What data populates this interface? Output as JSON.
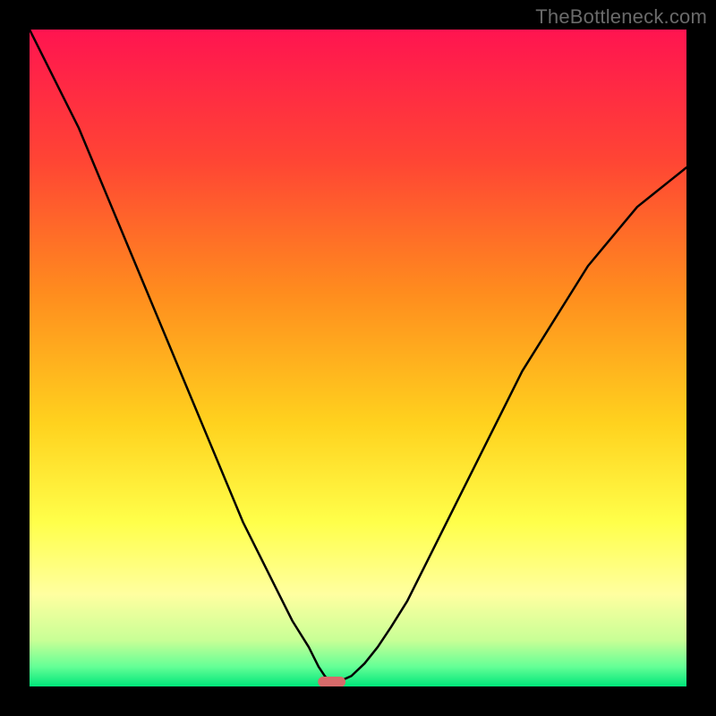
{
  "watermark": "TheBottleneck.com",
  "chart_data": {
    "type": "line",
    "title": "",
    "xlabel": "",
    "ylabel": "",
    "xlim": [
      0,
      100
    ],
    "ylim": [
      0,
      100
    ],
    "background": {
      "type": "vertical-gradient",
      "stops": [
        {
          "offset": 0.0,
          "color": "#ff1450"
        },
        {
          "offset": 0.2,
          "color": "#ff4534"
        },
        {
          "offset": 0.4,
          "color": "#ff8c1e"
        },
        {
          "offset": 0.6,
          "color": "#ffd21e"
        },
        {
          "offset": 0.75,
          "color": "#ffff4a"
        },
        {
          "offset": 0.86,
          "color": "#ffffa0"
        },
        {
          "offset": 0.93,
          "color": "#c8ff96"
        },
        {
          "offset": 0.97,
          "color": "#64ff96"
        },
        {
          "offset": 1.0,
          "color": "#00e67a"
        }
      ]
    },
    "series": [
      {
        "name": "bottleneck-curve",
        "color": "#000000",
        "width": 2.5,
        "x": [
          0,
          2.5,
          5,
          7.5,
          10,
          12.5,
          15,
          17.5,
          20,
          22.5,
          25,
          27.5,
          30,
          32.5,
          35,
          37.5,
          40,
          42.5,
          44,
          45,
          46,
          47,
          49,
          51,
          53,
          55,
          57.5,
          60,
          62.5,
          65,
          67.5,
          70,
          72.5,
          75,
          77.5,
          80,
          82.5,
          85,
          87.5,
          90,
          92.5,
          95,
          97.5,
          100
        ],
        "y": [
          100,
          95,
          90,
          85,
          79,
          73,
          67,
          61,
          55,
          49,
          43,
          37,
          31,
          25,
          20,
          15,
          10,
          6,
          3,
          1.5,
          0.7,
          0.7,
          1.6,
          3.5,
          6,
          9,
          13,
          18,
          23,
          28,
          33,
          38,
          43,
          48,
          52,
          56,
          60,
          64,
          67,
          70,
          73,
          75,
          77,
          79
        ]
      }
    ],
    "marker": {
      "name": "optimal-point",
      "shape": "rounded-rect",
      "color": "#d86a6a",
      "x_center": 46,
      "y_center": 0.7,
      "width_pct": 4.2,
      "height_pct": 1.6
    }
  }
}
